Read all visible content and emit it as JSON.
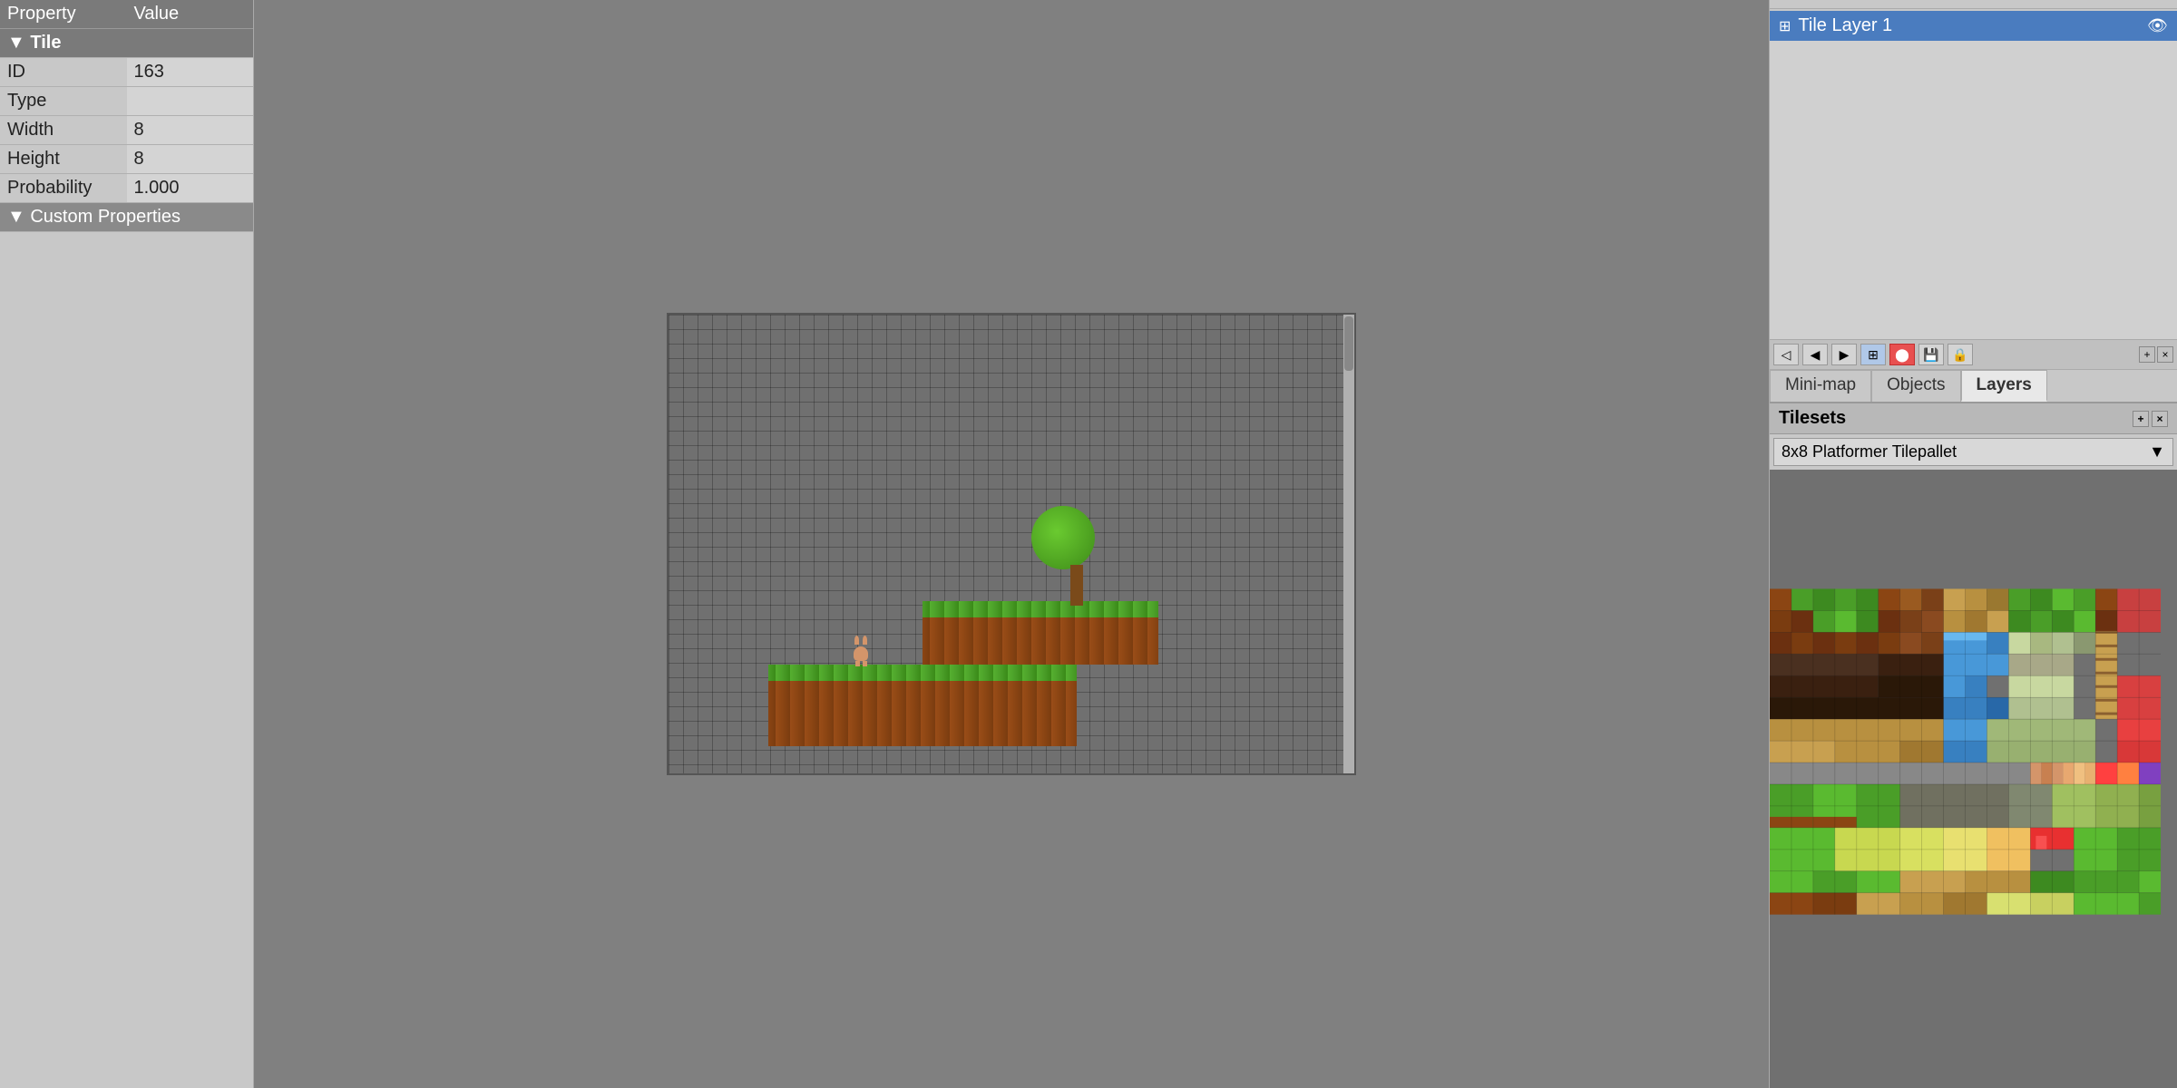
{
  "leftPanel": {
    "title": "Property",
    "valueHeader": "Value",
    "sectionTile": "Tile",
    "properties": [
      {
        "name": "ID",
        "value": "163"
      },
      {
        "name": "Type",
        "value": ""
      },
      {
        "name": "Width",
        "value": "8"
      },
      {
        "name": "Height",
        "value": "8"
      },
      {
        "name": "Probability",
        "value": "1.000"
      }
    ],
    "customProperties": "Custom Properties"
  },
  "rightPanel": {
    "layerName": "Tile Layer 1",
    "tabs": [
      "Mini-map",
      "Objects",
      "Layers"
    ],
    "activeTab": "Layers",
    "tilesets": "Tilesets",
    "tilesetName": "8x8 Platformer Tilepallet",
    "toolbarIcons": [
      "arrow-left",
      "arrow-left-2",
      "forward",
      "grid",
      "stop",
      "floppy",
      "lock"
    ],
    "panelResizeBtns": [
      "+",
      "x"
    ]
  }
}
